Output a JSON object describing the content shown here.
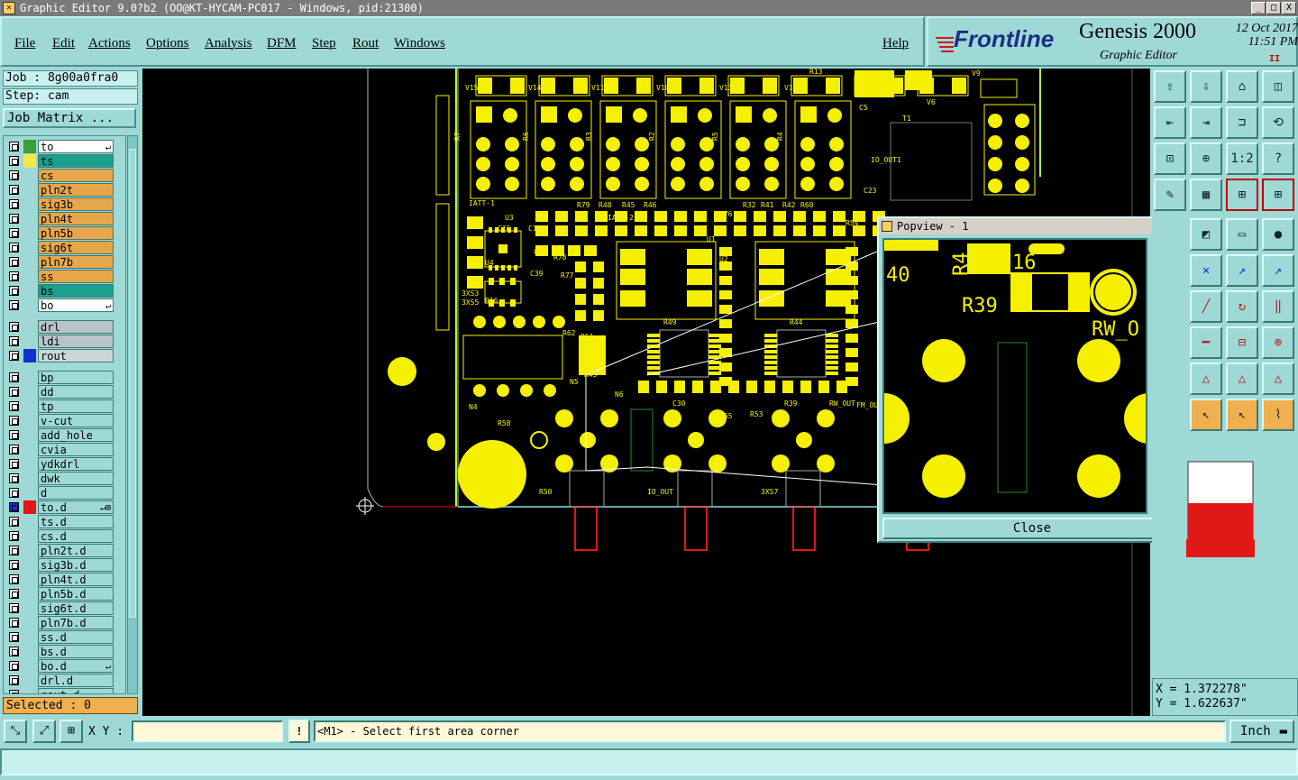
{
  "window": {
    "title": "Graphic Editor 9.0?b2 (OO@KT-HYCAM-PC017 - Windows, pid:21300)",
    "controls": [
      "_",
      "□",
      "X"
    ]
  },
  "menu": [
    "File",
    "Edit",
    "Actions",
    "Options",
    "Analysis",
    "DFM",
    "Step",
    "Rout",
    "Windows",
    "Help"
  ],
  "brand": {
    "logo": "Frontline",
    "product": "Genesis 2000",
    "subtitle": "Graphic Editor",
    "date": "12 Oct 2017",
    "time": "11:51 PM",
    "pause": "II"
  },
  "job": {
    "job_label": "Job : 8g00a0fra0",
    "step_label": "Step: cam",
    "matrix_button": "Job Matrix ..."
  },
  "layers": [
    {
      "name": "to",
      "color": "#ffffff",
      "swatch": "#3aa03a",
      "mark": "↵"
    },
    {
      "name": "ts",
      "color": "#1aa08c",
      "swatch": "#f4e84a",
      "mark": ""
    },
    {
      "name": "cs",
      "color": "#e8a64a",
      "swatch": "",
      "mark": ""
    },
    {
      "name": "pln2t",
      "color": "#e8a64a",
      "swatch": "",
      "mark": ""
    },
    {
      "name": "sig3b",
      "color": "#e8a64a",
      "swatch": "",
      "mark": ""
    },
    {
      "name": "pln4t",
      "color": "#e8a64a",
      "swatch": "",
      "mark": ""
    },
    {
      "name": "pln5b",
      "color": "#e8a64a",
      "swatch": "",
      "mark": ""
    },
    {
      "name": "sig6t",
      "color": "#e8a64a",
      "swatch": "",
      "mark": ""
    },
    {
      "name": "pln7b",
      "color": "#e8a64a",
      "swatch": "",
      "mark": ""
    },
    {
      "name": "ss",
      "color": "#e8a64a",
      "swatch": "",
      "mark": ""
    },
    {
      "name": "bs",
      "color": "#1aa08c",
      "swatch": "",
      "mark": ""
    },
    {
      "name": "bo",
      "color": "#ffffff",
      "swatch": "",
      "mark": "↵"
    },
    {
      "name": "drl",
      "color": "#b8c4c8",
      "swatch": "",
      "mark": ""
    },
    {
      "name": "ldi",
      "color": "#b8c4c8",
      "swatch": "",
      "mark": ""
    },
    {
      "name": "rout",
      "color": "#c8d8d8",
      "swatch": "#1530d0",
      "mark": ""
    },
    {
      "name": "bp",
      "color": "#9fd9d6",
      "swatch": "",
      "mark": ""
    },
    {
      "name": "dd",
      "color": "#9fd9d6",
      "swatch": "",
      "mark": ""
    },
    {
      "name": "tp",
      "color": "#9fd9d6",
      "swatch": "",
      "mark": ""
    },
    {
      "name": "v-cut",
      "color": "#9fd9d6",
      "swatch": "",
      "mark": ""
    },
    {
      "name": "add_hole",
      "color": "#9fd9d6",
      "swatch": "",
      "mark": ""
    },
    {
      "name": "cvia",
      "color": "#9fd9d6",
      "swatch": "",
      "mark": ""
    },
    {
      "name": "ydkdrl",
      "color": "#9fd9d6",
      "swatch": "",
      "mark": ""
    },
    {
      "name": "dwk",
      "color": "#9fd9d6",
      "swatch": "",
      "mark": ""
    },
    {
      "name": "d",
      "color": "#9fd9d6",
      "swatch": "",
      "mark": ""
    },
    {
      "name": "to.d",
      "color": "#9fd9d6",
      "swatch": "#e01818",
      "mark": "↵⊞"
    },
    {
      "name": "ts.d",
      "color": "#9fd9d6",
      "swatch": "",
      "mark": ""
    },
    {
      "name": "cs.d",
      "color": "#9fd9d6",
      "swatch": "",
      "mark": ""
    },
    {
      "name": "pln2t.d",
      "color": "#9fd9d6",
      "swatch": "",
      "mark": ""
    },
    {
      "name": "sig3b.d",
      "color": "#9fd9d6",
      "swatch": "",
      "mark": ""
    },
    {
      "name": "pln4t.d",
      "color": "#9fd9d6",
      "swatch": "",
      "mark": ""
    },
    {
      "name": "pln5b.d",
      "color": "#9fd9d6",
      "swatch": "",
      "mark": ""
    },
    {
      "name": "sig6t.d",
      "color": "#9fd9d6",
      "swatch": "",
      "mark": ""
    },
    {
      "name": "pln7b.d",
      "color": "#9fd9d6",
      "swatch": "",
      "mark": ""
    },
    {
      "name": "ss.d",
      "color": "#9fd9d6",
      "swatch": "",
      "mark": ""
    },
    {
      "name": "bs.d",
      "color": "#9fd9d6",
      "swatch": "",
      "mark": ""
    },
    {
      "name": "bo.d",
      "color": "#9fd9d6",
      "swatch": "",
      "mark": "↵"
    },
    {
      "name": "drl.d",
      "color": "#9fd9d6",
      "swatch": "",
      "mark": ""
    },
    {
      "name": "rout.d",
      "color": "#9fd9d6",
      "swatch": "",
      "mark": ""
    }
  ],
  "selected": "Selected : 0",
  "board_labels": [
    "V15",
    "V14",
    "V11",
    "V10",
    "V13",
    "V12",
    "R13",
    "V9",
    "V6",
    "C5",
    "T1",
    "IO_OUT1",
    "C23",
    "R7",
    "R6",
    "R3",
    "R2",
    "R5",
    "R4",
    "IATT-1",
    "IATT-2",
    "U3",
    "U4",
    "U1",
    "U2",
    "C28",
    "C35",
    "C39",
    "R78",
    "R77",
    "R76",
    "R79",
    "R48",
    "R45",
    "R46",
    "R32",
    "R41",
    "R42",
    "R60",
    "R54",
    "R51",
    "R62",
    "R43",
    "R49",
    "R44",
    "N4",
    "N5",
    "N6",
    "C30",
    "R39",
    "RW_OUT",
    "FM_OUT",
    "R53",
    "R55",
    "R58",
    "R50",
    "IO_OUT",
    "3XS7",
    "3XS3",
    "3XS5",
    "R16",
    "C16",
    "C17"
  ],
  "popview": {
    "title": "Popview - 1",
    "labels": [
      "40",
      "R4",
      "16",
      "R39",
      "RW_O"
    ],
    "close_label": "Close"
  },
  "coords": {
    "x": "X = 1.372278\"",
    "y": "Y = 1.622637\""
  },
  "status": {
    "xy_label": "X Y :",
    "xy_value": "",
    "bang": "!",
    "prompt": "<M1> - Select first area corner",
    "units": "Inch"
  },
  "colors": {
    "panel": "#9fd9d6",
    "copper": "#f4f000",
    "canvas": "#000000",
    "accent_red": "#e01818",
    "brand_blue": "#1a2f86"
  },
  "toolbox_icons": [
    "move-up-icon",
    "move-down-icon",
    "home-icon",
    "panel-icon",
    "left-icon",
    "right-icon",
    "flip-icon",
    "swap-icon",
    "fit-icon",
    "center-icon",
    "one-to-two-icon",
    "help-icon",
    "brush-icon",
    "grid-icon",
    "layers-icon",
    "layers-active-icon",
    "zoom-box-icon",
    "ruler-icon",
    "dot-icon",
    "cross-icon",
    "add-point-icon",
    "add-arc-icon",
    "line-icon",
    "arc-icon",
    "split-icon",
    "minus-icon",
    "measure-icon",
    "drop-icon",
    "peak-icon",
    "peak2-icon",
    "peak3-icon",
    "pointer-icon",
    "pointer2-icon",
    "snap-icon"
  ]
}
